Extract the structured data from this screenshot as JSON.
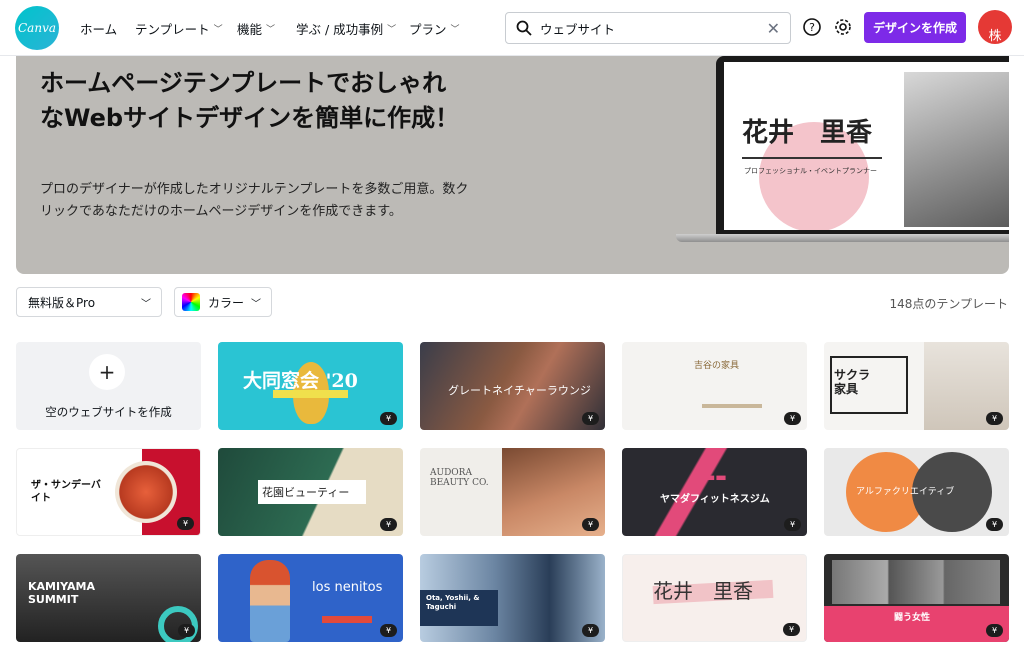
{
  "header": {
    "logo_text": "Canva",
    "nav": [
      {
        "label": "ホーム"
      },
      {
        "label": "テンプレート",
        "dropdown": true
      },
      {
        "label": "機能",
        "dropdown": true
      },
      {
        "label": "学ぶ / 成功事例",
        "dropdown": true
      },
      {
        "label": "プラン",
        "dropdown": true
      }
    ],
    "search_value": "ウェブサイト",
    "create_label": "デザインを作成",
    "avatar_text": "株"
  },
  "hero": {
    "title": "ホームページテンプレートでおしゃれなWebサイトデザインを簡単に作成！",
    "description": "プロのデザイナーが作成したオリジナルテンプレートを多数ご用意。数クリックであなただけのホームページデザインを作成できます。",
    "preview_name": "花井　里香",
    "preview_sub": "プロフェッショナル・イベントプランナー"
  },
  "filters": {
    "plan": "無料版＆Pro",
    "color": "カラー"
  },
  "result_count": "148点のテンプレート",
  "create_empty": "空のウェブサイトを作成",
  "badge": "¥",
  "templates": [
    {
      "title": "大同窓会 '20",
      "sub": "",
      "bg": "#2ac4d3"
    },
    {
      "title": "グレートネイチャーラウンジ",
      "sub": "",
      "bg": "#5c4a44"
    },
    {
      "title": "吉谷の家具",
      "sub": "",
      "bg": "#f4f3f1"
    },
    {
      "title": "サクラ家具",
      "sub": "",
      "bg": "#f5f4f2"
    },
    {
      "title": "ザ・サンデーバイト",
      "sub": "",
      "bg": "#fff"
    },
    {
      "title": "花園ビューティー",
      "sub": "",
      "bg": "#e6dcc4"
    },
    {
      "title": "AUDORA BEAUTY CO.",
      "sub": "",
      "bg": "#f0eeea"
    },
    {
      "title": "ヤマダフィットネスジム",
      "sub": "",
      "bg": "#2a2a30"
    },
    {
      "title": "アルファクリエイティブ",
      "sub": "",
      "bg": "#e9e9e9"
    },
    {
      "title": "KAMIYAMA SUMMIT",
      "sub": "",
      "bg": "#333"
    },
    {
      "title": "los nenitos",
      "sub": "",
      "bg": "#2f63c9"
    },
    {
      "title": "Ota, Yoshii, & Taguchi",
      "sub": "",
      "bg": "#9db4c8"
    },
    {
      "title": "花井　里香",
      "sub": "",
      "bg": "#f7efec"
    },
    {
      "title": "闘う女性",
      "sub": "",
      "bg": "#2b2b2b"
    }
  ]
}
